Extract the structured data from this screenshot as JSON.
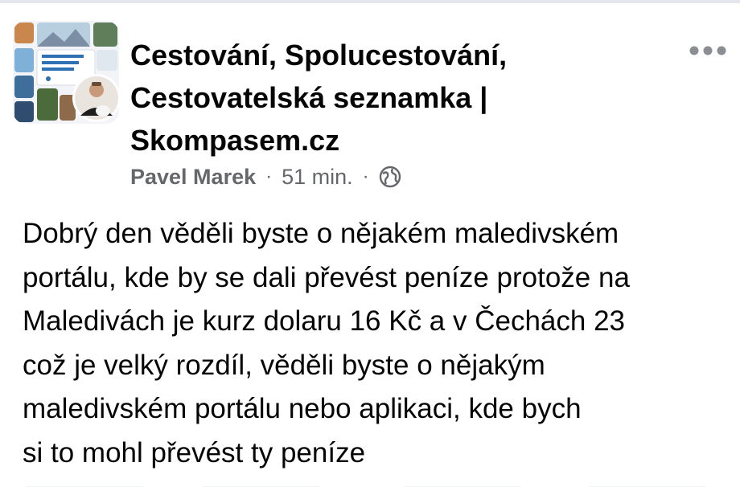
{
  "post": {
    "group_name": "Cestování, Spolucestování, Cestovatelská seznamka | Skompasem.cz",
    "author": "Pavel Marek",
    "separator": "·",
    "time": "51 min.",
    "privacy_icon": "globe-icon",
    "more_icon": "more-horizontal-icon",
    "text": "Dobrý den věděli byste o nějakém maledivském\nportálu, kde by se dali převést peníze protože na\nMaledivách je kurz dolaru 16 Kč a v Čechách 23\ncož je velký rozdíl, věděli byste o nějakým\nmaledivském portálu nebo  aplikaci, kde bych\nsi to mohl převést ty peníze"
  },
  "colors": {
    "text_primary": "#050505",
    "text_secondary": "#65676b",
    "divider": "#e4e6eb"
  }
}
